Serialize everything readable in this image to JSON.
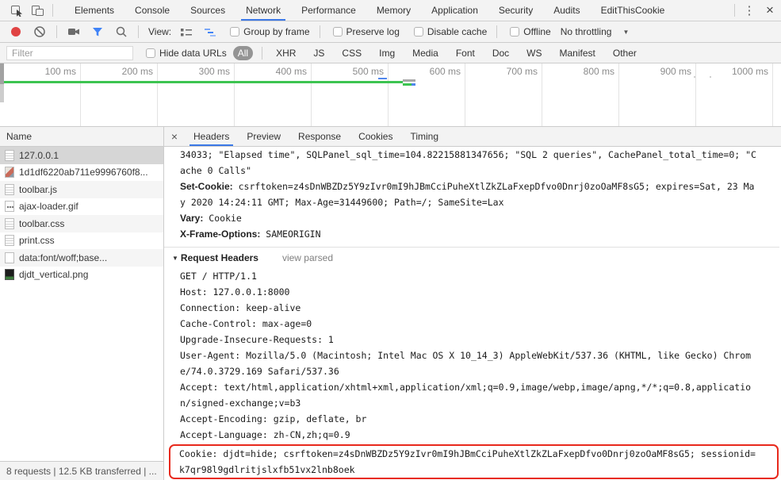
{
  "tabbar": {
    "tabs": [
      "Elements",
      "Console",
      "Sources",
      "Network",
      "Performance",
      "Memory",
      "Application",
      "Security",
      "Audits",
      "EditThisCookie"
    ],
    "active_tab": "Network",
    "kebab_glyph": "⋮",
    "close_glyph": "×"
  },
  "toolbar": {
    "view_label": "View:",
    "group_by_frame": "Group by frame",
    "preserve_log": "Preserve log",
    "disable_cache": "Disable cache",
    "offline": "Offline",
    "throttling": "No throttling",
    "dropdown_glyph": "▼"
  },
  "filterbar": {
    "placeholder": "Filter",
    "hide_data_urls": "Hide data URLs",
    "types": [
      "All",
      "XHR",
      "JS",
      "CSS",
      "Img",
      "Media",
      "Font",
      "Doc",
      "WS",
      "Manifest",
      "Other"
    ],
    "selected_type": "All"
  },
  "overview": {
    "labels": [
      "100 ms",
      "200 ms",
      "300 ms",
      "400 ms",
      "500 ms",
      "600 ms",
      "700 ms",
      "800 ms",
      "900 ms",
      "1000 ms"
    ]
  },
  "requests": {
    "column_header": "Name",
    "rows": [
      {
        "name": "127.0.0.1",
        "icon": "document-icon",
        "selected": true
      },
      {
        "name": "1d1df6220ab711e9996760f8...",
        "icon": "image-icon"
      },
      {
        "name": "toolbar.js",
        "icon": "script-icon"
      },
      {
        "name": "ajax-loader.gif",
        "icon": "image-icon"
      },
      {
        "name": "toolbar.css",
        "icon": "stylesheet-icon"
      },
      {
        "name": "print.css",
        "icon": "stylesheet-icon"
      },
      {
        "name": "data:font/woff;base...",
        "icon": "font-icon"
      },
      {
        "name": "djdt_vertical.png",
        "icon": "image-icon"
      }
    ]
  },
  "detail": {
    "close_glyph": "×",
    "tabs": [
      "Headers",
      "Preview",
      "Response",
      "Cookies",
      "Timing"
    ],
    "active_tab": "Headers"
  },
  "headers_view": {
    "response_overflow_line1": "34033; \"Elapsed time\", SQLPanel_sql_time=104.82215881347656; \"SQL 2 queries\", CachePanel_total_time=0; \"C",
    "response_overflow_line2": "ache 0 Calls\"",
    "set_cookie_name": "Set-Cookie:",
    "set_cookie_value_line1": "csrftoken=z4sDnWBZDz5Y9zIvr0mI9hJBmCciPuheXtlZkZLaFxepDfvo0Dnrj0zoOaMF8sG5; expires=Sat, 23 Ma",
    "set_cookie_value_line2": "y 2020 14:24:11 GMT; Max-Age=31449600; Path=/; SameSite=Lax",
    "vary_name": "Vary:",
    "vary_value": "Cookie",
    "x_frame_options_name": "X-Frame-Options:",
    "x_frame_options_value": "SAMEORIGIN",
    "disclosure": "▼",
    "request_headers_title": "Request Headers",
    "view_parsed_label": "view parsed",
    "request_lines": [
      "GET / HTTP/1.1",
      "Host: 127.0.0.1:8000",
      "Connection: keep-alive",
      "Cache-Control: max-age=0",
      "Upgrade-Insecure-Requests: 1",
      "User-Agent: Mozilla/5.0 (Macintosh; Intel Mac OS X 10_14_3) AppleWebKit/537.36 (KHTML, like Gecko) Chrom",
      "e/74.0.3729.169 Safari/537.36",
      "Accept: text/html,application/xhtml+xml,application/xml;q=0.9,image/webp,image/apng,*/*;q=0.8,applicatio",
      "n/signed-exchange;v=b3",
      "Accept-Encoding: gzip, deflate, br",
      "Accept-Language: zh-CN,zh;q=0.9"
    ],
    "cookie_highlight_line1": "Cookie: djdt=hide; csrftoken=z4sDnWBZDz5Y9zIvr0mI9hJBmCciPuheXtlZkZLaFxepDfvo0Dnrj0zoOaMF8sG5; sessionid=",
    "cookie_highlight_line2": "k7qr98l9gdlritjslxfb51vx2lnb8oek"
  },
  "statusbar": {
    "text": "8 requests | 12.5 KB transferred | ..."
  },
  "colors": {
    "accent_blue": "#3b78e7",
    "record_red": "#e04343",
    "overview_green": "#3dc451",
    "waterfall_blue": "#4f86ec",
    "highlight_red": "#e8291c",
    "filter_funnel_blue": "#4083f7"
  }
}
